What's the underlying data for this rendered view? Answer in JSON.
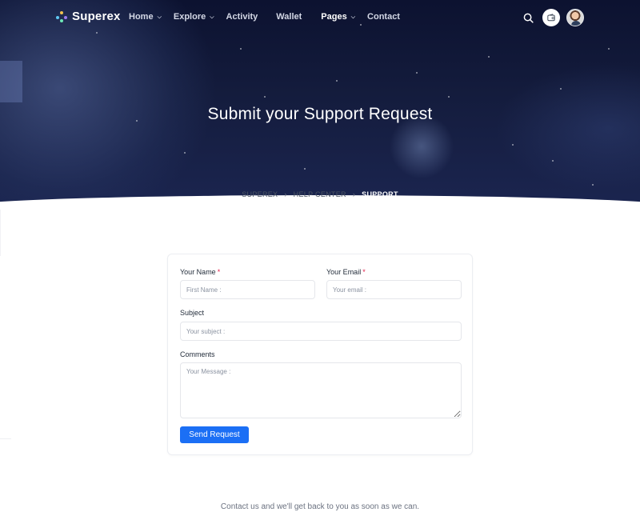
{
  "brand": {
    "name": "Superex"
  },
  "nav": {
    "items": [
      {
        "label": "Home",
        "has_dropdown": true,
        "active": false
      },
      {
        "label": "Explore",
        "has_dropdown": true,
        "active": false
      },
      {
        "label": "Activity",
        "has_dropdown": false,
        "active": false
      },
      {
        "label": "Wallet",
        "has_dropdown": false,
        "active": false
      },
      {
        "label": "Pages",
        "has_dropdown": true,
        "active": true
      },
      {
        "label": "Contact",
        "has_dropdown": false,
        "active": false
      }
    ],
    "icons": [
      "search-icon",
      "wallet-icon",
      "user-avatar"
    ]
  },
  "hero": {
    "title": "Submit your Support Request",
    "breadcrumb": [
      "SUPEREX",
      "HELP CENTER",
      "SUPPORT"
    ],
    "separator": "›"
  },
  "form": {
    "name_label": "Your Name",
    "name_placeholder": "First Name :",
    "email_label": "Your Email",
    "email_placeholder": "Your email :",
    "required_mark": "*",
    "subject_label": "Subject",
    "subject_placeholder": "Your subject :",
    "comments_label": "Comments",
    "comments_placeholder": "Your Message :",
    "submit_label": "Send Request"
  },
  "footer_note": "Contact us and we'll get back to you as soon as we can.",
  "colors": {
    "accent": "#1b6ff5",
    "hero_bg": "#141c3d",
    "required": "#e11d48"
  }
}
